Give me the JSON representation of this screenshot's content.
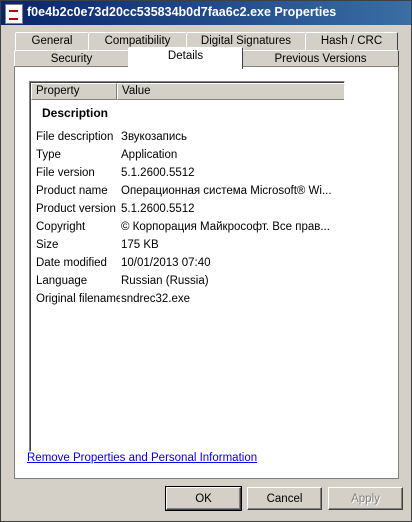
{
  "window": {
    "title": "f0e4b2c0e73d20cc535834b0d7faa6c2.exe Properties"
  },
  "tabs": {
    "row1": [
      "General",
      "Compatibility",
      "Digital Signatures",
      "Hash / CRC"
    ],
    "row2": [
      "Security",
      "Details",
      "Previous Versions"
    ],
    "active": "Details"
  },
  "details": {
    "columns": {
      "property": "Property",
      "value": "Value"
    },
    "group_heading": "Description",
    "rows": [
      {
        "property": "File description",
        "value": "Звукозапись"
      },
      {
        "property": "Type",
        "value": "Application"
      },
      {
        "property": "File version",
        "value": "5.1.2600.5512"
      },
      {
        "property": "Product name",
        "value": "Операционная система Microsoft® Wi..."
      },
      {
        "property": "Product version",
        "value": "5.1.2600.5512"
      },
      {
        "property": "Copyright",
        "value": "© Корпорация Майкрософт. Все прав..."
      },
      {
        "property": "Size",
        "value": "175 KB"
      },
      {
        "property": "Date modified",
        "value": "10/01/2013 07:40"
      },
      {
        "property": "Language",
        "value": "Russian (Russia)"
      },
      {
        "property": "Original filename",
        "value": "sndrec32.exe"
      }
    ]
  },
  "remove_link": "Remove Properties and Personal Information",
  "buttons": {
    "ok": "OK",
    "cancel": "Cancel",
    "apply": "Apply"
  },
  "icons": {
    "title": "exe-file-icon"
  }
}
